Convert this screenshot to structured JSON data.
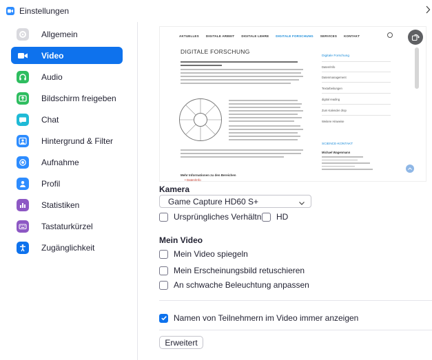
{
  "window": {
    "title": "Einstellungen"
  },
  "sidebar": {
    "items": [
      {
        "label": "Allgemein",
        "icon": "gear-icon",
        "color": "#d9d9de"
      },
      {
        "label": "Video",
        "icon": "video-camera-icon",
        "color": "#0e72ed",
        "active": true
      },
      {
        "label": "Audio",
        "icon": "headphones-icon",
        "color": "#2ebd5f"
      },
      {
        "label": "Bildschirm freigeben",
        "icon": "share-screen-icon",
        "color": "#2ebd5f"
      },
      {
        "label": "Chat",
        "icon": "chat-bubble-icon",
        "color": "#1fbad6"
      },
      {
        "label": "Hintergrund & Filter",
        "icon": "background-portrait-icon",
        "color": "#2d8cff"
      },
      {
        "label": "Aufnahme",
        "icon": "record-icon",
        "color": "#2d8cff"
      },
      {
        "label": "Profil",
        "icon": "profile-icon",
        "color": "#2d8cff"
      },
      {
        "label": "Statistiken",
        "icon": "statistics-icon",
        "color": "#8d58c4"
      },
      {
        "label": "Tastaturkürzel",
        "icon": "keyboard-icon",
        "color": "#8d58c4"
      },
      {
        "label": "Zugänglichkeit",
        "icon": "accessibility-icon",
        "color": "#0e72ed"
      }
    ]
  },
  "preview": {
    "nav": [
      "AKTUELLES",
      "DIGITALE ARBEIT",
      "DIGITALE LEHRE",
      "DIGITALE FORSCHUNG",
      "SERVICES",
      "KONTAKT"
    ],
    "heading": "DIGITALE FORSCHUNG",
    "side_links": [
      "Digitale Forschung",
      "Daten/Info",
      "Datenmanagement",
      "Textarbeitungen",
      "digital reading",
      "Zum Kalender drop",
      "Weitere Hinweise"
    ],
    "side_contact_title": "SCIENCE-KONTAKT",
    "side_contact_name": "Michael Wagenmann",
    "link_title": "Mehr Informationen zu den Bereichen",
    "link_item": "• Daten/Info"
  },
  "camera": {
    "section_title": "Kamera",
    "selected": "Game Capture HD60 S+",
    "options": [
      {
        "label": "Ursprüngliches Verhältnis",
        "checked": false
      },
      {
        "label": "HD",
        "checked": false
      }
    ]
  },
  "my_video": {
    "section_title": "Mein Video",
    "options": [
      {
        "label": "Mein Video spiegeln",
        "checked": false
      },
      {
        "label": "Mein Erscheinungsbild retuschieren",
        "checked": false
      },
      {
        "label": "An schwache Beleuchtung anpassen",
        "checked": false
      }
    ]
  },
  "names": {
    "label": "Namen von Teilnehmern im Video immer anzeigen",
    "checked": true
  },
  "advanced_button": "Erweitert",
  "colors": {
    "accent": "#0e72ed",
    "text": "#232333"
  }
}
